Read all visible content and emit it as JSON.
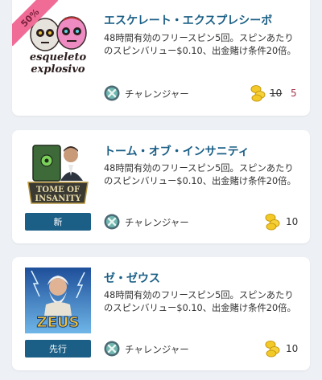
{
  "colors": {
    "title": "#1b5f86",
    "button_bg": "#1b5f86",
    "discount_ribbon": "#f06c97",
    "sale_price": "#a3334a",
    "page_bg": "#edf0f4"
  },
  "cards": [
    {
      "discount": "50%",
      "image_icon": "esqueleto-explosivo-game-art",
      "image_text_1": "esqueleto",
      "image_text_2": "explosivo",
      "title": "エスケレート・エクスプレシーボ",
      "description": "48時間有効のフリースピン5回。スピンあたりのスピンバリュー$0.10、出金賭け条件20倍。",
      "level_icon": "challenger-level-icon",
      "level_label": "チャレンジャー",
      "coin_icon": "coins-icon",
      "original_price": "10",
      "sale_price": "5"
    },
    {
      "tag": "新",
      "image_icon": "tome-of-insanity-game-art",
      "image_text_1": "TOME OF",
      "image_text_2": "INSANITY",
      "title": "トーム・オブ・インサニティ",
      "description": "48時間有効のフリースピン5回。スピンあたりのスピンバリュー$0.10、出金賭け条件20倍。",
      "level_icon": "challenger-level-icon",
      "level_label": "チャレンジャー",
      "coin_icon": "coins-icon",
      "price": "10"
    },
    {
      "tag": "先行",
      "image_icon": "zeus-game-art",
      "image_text_1": "ZEUS",
      "title": "ゼ・ゼウス",
      "description": "48時間有効のフリースピン5回。スピンあたりのスピンバリュー$0.10、出金賭け条件20倍。",
      "level_icon": "challenger-level-icon",
      "level_label": "チャレンジャー",
      "coin_icon": "coins-icon",
      "price": "10"
    }
  ]
}
